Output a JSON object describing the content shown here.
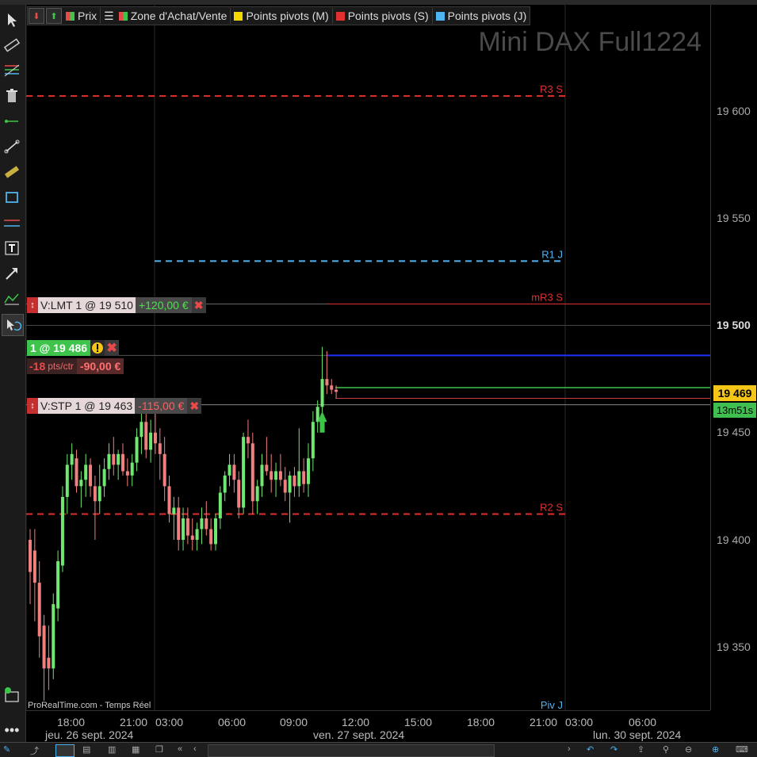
{
  "instrument_title": "Mini DAX Full1224",
  "legend": [
    {
      "label": "Prix"
    },
    {
      "label": "Zone d'Achat/Vente"
    },
    {
      "label": "Points pivots (M)",
      "color": "#f5d800"
    },
    {
      "label": "Points pivots (S)",
      "color": "#e03030"
    },
    {
      "label": "Points pivots (J)",
      "color": "#4fb3f0"
    }
  ],
  "price_axis": {
    "labels": [
      "19 600",
      "19 550",
      "19 500",
      "19 450",
      "19 400",
      "19 350"
    ],
    "current_price": "19 469",
    "timer": "13m51s"
  },
  "time_axis": {
    "times": [
      "18:00",
      "21:00",
      "03:00",
      "06:00",
      "09:00",
      "12:00",
      "15:00",
      "18:00",
      "21:00",
      "03:00",
      "06:00"
    ],
    "dates": [
      "jeu. 26 sept. 2024",
      "ven. 27 sept. 2024",
      "lun. 30 sept. 2024"
    ]
  },
  "pivot_levels": [
    {
      "label": "R3 S",
      "price": 19607,
      "color": "#e03030"
    },
    {
      "label": "R1 J",
      "price": 19530,
      "color": "#4fb3f0"
    },
    {
      "label": "mR3 S",
      "price": 19510,
      "color": "#e03030"
    },
    {
      "label": "R2 S",
      "price": 19412,
      "color": "#e03030"
    },
    {
      "label": "Piv J",
      "price": 19331,
      "color": "#4fb3f0"
    }
  ],
  "orders": {
    "limit": {
      "label": "V:LMT 1 @ 19 510",
      "pnl": "+120,00 €"
    },
    "stop": {
      "label": "V:STP 1 @ 19 463",
      "pnl": "-115,00 €"
    }
  },
  "position": {
    "qty_label": "1 @ 19 486",
    "pts": "-18",
    "pts_unit": "pts/ctr",
    "pnl": "-90,00 €"
  },
  "footer": "ProRealTime.com - Temps Réel",
  "colors": {
    "up": "#6ee870",
    "down": "#f08080",
    "position_line": "#2030ff"
  },
  "chart_data": {
    "type": "candlestick",
    "series": [
      {
        "o": 19400,
        "h": 19405,
        "l": 19370,
        "c": 19385
      },
      {
        "o": 19395,
        "h": 19405,
        "l": 19362,
        "c": 19380
      },
      {
        "o": 19380,
        "h": 19390,
        "l": 19345,
        "c": 19355
      },
      {
        "o": 19360,
        "h": 19365,
        "l": 19325,
        "c": 19340
      },
      {
        "o": 19345,
        "h": 19360,
        "l": 19330,
        "c": 19340
      },
      {
        "o": 19340,
        "h": 19375,
        "l": 19335,
        "c": 19370
      },
      {
        "o": 19368,
        "h": 19395,
        "l": 19362,
        "c": 19390
      },
      {
        "o": 19388,
        "h": 19425,
        "l": 19385,
        "c": 19420
      },
      {
        "o": 19420,
        "h": 19440,
        "l": 19412,
        "c": 19435
      },
      {
        "o": 19435,
        "h": 19445,
        "l": 19428,
        "c": 19440
      },
      {
        "o": 19438,
        "h": 19442,
        "l": 19422,
        "c": 19425
      },
      {
        "o": 19425,
        "h": 19432,
        "l": 19415,
        "c": 19428
      },
      {
        "o": 19428,
        "h": 19440,
        "l": 19420,
        "c": 19435
      },
      {
        "o": 19435,
        "h": 19438,
        "l": 19420,
        "c": 19425
      },
      {
        "o": 19425,
        "h": 19430,
        "l": 19400,
        "c": 19418
      },
      {
        "o": 19418,
        "h": 19435,
        "l": 19412,
        "c": 19425
      },
      {
        "o": 19425,
        "h": 19438,
        "l": 19420,
        "c": 19433
      },
      {
        "o": 19433,
        "h": 19445,
        "l": 19428,
        "c": 19440
      },
      {
        "o": 19440,
        "h": 19448,
        "l": 19430,
        "c": 19435
      },
      {
        "o": 19435,
        "h": 19442,
        "l": 19428,
        "c": 19440
      },
      {
        "o": 19440,
        "h": 19445,
        "l": 19430,
        "c": 19432
      },
      {
        "o": 19432,
        "h": 19438,
        "l": 19425,
        "c": 19430
      },
      {
        "o": 19430,
        "h": 19440,
        "l": 19425,
        "c": 19436
      },
      {
        "o": 19436,
        "h": 19452,
        "l": 19432,
        "c": 19448
      },
      {
        "o": 19448,
        "h": 19463,
        "l": 19440,
        "c": 19455
      },
      {
        "o": 19455,
        "h": 19462,
        "l": 19438,
        "c": 19442
      },
      {
        "o": 19442,
        "h": 19456,
        "l": 19436,
        "c": 19450
      },
      {
        "o": 19450,
        "h": 19460,
        "l": 19440,
        "c": 19445
      },
      {
        "o": 19445,
        "h": 19452,
        "l": 19428,
        "c": 19440
      },
      {
        "o": 19440,
        "h": 19448,
        "l": 19418,
        "c": 19425
      },
      {
        "o": 19425,
        "h": 19430,
        "l": 19408,
        "c": 19412
      },
      {
        "o": 19412,
        "h": 19420,
        "l": 19400,
        "c": 19415
      },
      {
        "o": 19415,
        "h": 19420,
        "l": 19395,
        "c": 19400
      },
      {
        "o": 19400,
        "h": 19415,
        "l": 19395,
        "c": 19410
      },
      {
        "o": 19410,
        "h": 19415,
        "l": 19398,
        "c": 19402
      },
      {
        "o": 19402,
        "h": 19410,
        "l": 19395,
        "c": 19400
      },
      {
        "o": 19400,
        "h": 19408,
        "l": 19395,
        "c": 19405
      },
      {
        "o": 19405,
        "h": 19415,
        "l": 19398,
        "c": 19410
      },
      {
        "o": 19410,
        "h": 19418,
        "l": 19402,
        "c": 19405
      },
      {
        "o": 19405,
        "h": 19410,
        "l": 19395,
        "c": 19398
      },
      {
        "o": 19398,
        "h": 19412,
        "l": 19395,
        "c": 19410
      },
      {
        "o": 19410,
        "h": 19425,
        "l": 19405,
        "c": 19422
      },
      {
        "o": 19422,
        "h": 19432,
        "l": 19418,
        "c": 19430
      },
      {
        "o": 19430,
        "h": 19440,
        "l": 19425,
        "c": 19435
      },
      {
        "o": 19435,
        "h": 19440,
        "l": 19422,
        "c": 19428
      },
      {
        "o": 19428,
        "h": 19432,
        "l": 19410,
        "c": 19415
      },
      {
        "o": 19415,
        "h": 19450,
        "l": 19412,
        "c": 19448
      },
      {
        "o": 19448,
        "h": 19456,
        "l": 19438,
        "c": 19445
      },
      {
        "o": 19445,
        "h": 19450,
        "l": 19412,
        "c": 19418
      },
      {
        "o": 19418,
        "h": 19428,
        "l": 19412,
        "c": 19425
      },
      {
        "o": 19425,
        "h": 19440,
        "l": 19420,
        "c": 19435
      },
      {
        "o": 19435,
        "h": 19448,
        "l": 19430,
        "c": 19432
      },
      {
        "o": 19432,
        "h": 19440,
        "l": 19422,
        "c": 19428
      },
      {
        "o": 19428,
        "h": 19436,
        "l": 19420,
        "c": 19432
      },
      {
        "o": 19432,
        "h": 19440,
        "l": 19425,
        "c": 19428
      },
      {
        "o": 19428,
        "h": 19434,
        "l": 19418,
        "c": 19422
      },
      {
        "o": 19422,
        "h": 19432,
        "l": 19408,
        "c": 19430
      },
      {
        "o": 19430,
        "h": 19434,
        "l": 19420,
        "c": 19425
      },
      {
        "o": 19425,
        "h": 19452,
        "l": 19420,
        "c": 19432
      },
      {
        "o": 19432,
        "h": 19438,
        "l": 19422,
        "c": 19426
      },
      {
        "o": 19426,
        "h": 19445,
        "l": 19420,
        "c": 19438
      },
      {
        "o": 19438,
        "h": 19460,
        "l": 19432,
        "c": 19455
      },
      {
        "o": 19455,
        "h": 19465,
        "l": 19450,
        "c": 19462
      },
      {
        "o": 19462,
        "h": 19490,
        "l": 19455,
        "c": 19475
      },
      {
        "o": 19475,
        "h": 19488,
        "l": 19468,
        "c": 19472
      },
      {
        "o": 19472,
        "h": 19475,
        "l": 19468,
        "c": 19470
      },
      {
        "o": 19470,
        "h": 19472,
        "l": 19466,
        "c": 19469
      }
    ]
  }
}
